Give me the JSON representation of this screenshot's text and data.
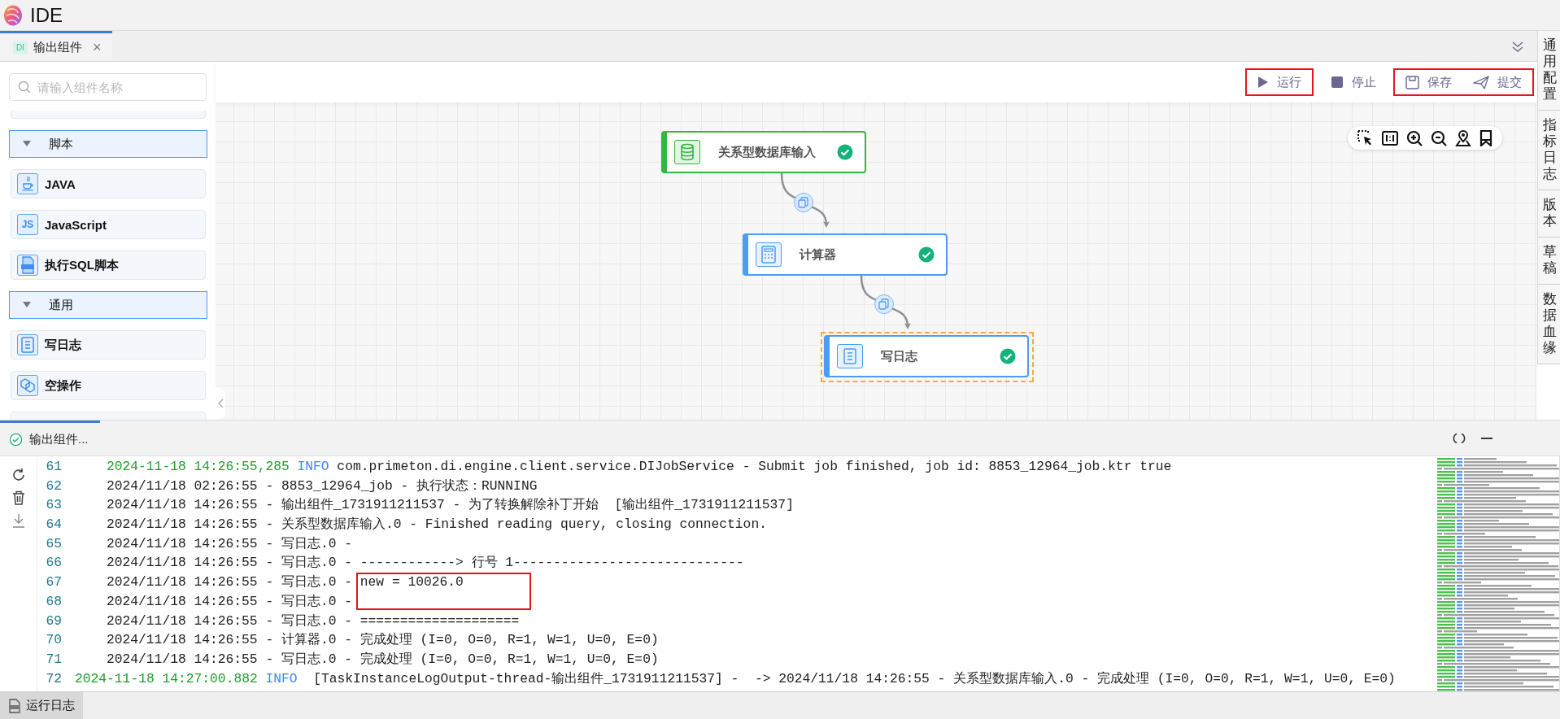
{
  "app": {
    "title": "IDE"
  },
  "tabs": [
    {
      "badge": "DI",
      "label": "输出组件",
      "close": "×",
      "selected": true
    }
  ],
  "sidebar": {
    "search": {
      "placeholder": "请输入组件名称"
    },
    "groups": [
      {
        "label": "脚本",
        "expanded": true,
        "items": [
          {
            "kind": "java",
            "label": "JAVA"
          },
          {
            "kind": "javascript",
            "badge": "JS",
            "label": "JavaScript"
          },
          {
            "kind": "sql",
            "label": "执行SQL脚本"
          }
        ]
      },
      {
        "label": "通用",
        "expanded": true,
        "items": [
          {
            "kind": "log",
            "label": "写日志"
          },
          {
            "kind": "noop",
            "label": "空操作"
          }
        ]
      }
    ]
  },
  "toolbar": {
    "groups": [
      {
        "highlighted": true,
        "buttons": [
          {
            "kind": "run",
            "label": "运行"
          }
        ]
      },
      {
        "highlighted": false,
        "buttons": [
          {
            "kind": "stop",
            "label": "停止"
          }
        ]
      },
      {
        "highlighted": true,
        "buttons": [
          {
            "kind": "save",
            "label": "保存"
          },
          {
            "kind": "submit",
            "label": "提交"
          }
        ]
      }
    ]
  },
  "canvas": {
    "tools": [
      {
        "kind": "select"
      },
      {
        "kind": "actual-size"
      },
      {
        "kind": "zoom-in"
      },
      {
        "kind": "zoom-out"
      },
      {
        "kind": "locate"
      },
      {
        "kind": "bookmark"
      }
    ],
    "nodes": [
      {
        "kind": "database",
        "label": "关系型数据库输入",
        "done": true,
        "selected": false,
        "color": "#35b544"
      },
      {
        "kind": "calculator",
        "label": "计算器",
        "done": true,
        "selected": false,
        "color": "#4a9cf7"
      },
      {
        "kind": "log",
        "label": "写日志",
        "done": true,
        "selected": true,
        "color": "#4a9cf7"
      }
    ]
  },
  "right_panel": {
    "tabs": [
      {
        "label": "通用配置"
      },
      {
        "label": "指标日志"
      },
      {
        "label": "版本"
      },
      {
        "label": "草稿"
      },
      {
        "label": "数据血缘"
      }
    ]
  },
  "run_panel": {
    "tab": {
      "label": "输出组件...",
      "done": true
    },
    "lines": [
      {
        "number": "61",
        "kind": "info",
        "indented": true,
        "time": "2024-11-18 14:26:55,285",
        "severity": "INFO",
        "message": " com.primeton.di.engine.client.service.DIJobService - Submit job finished, job id: 8853_12964_job.ktr true"
      },
      {
        "number": "62",
        "kind": "plain",
        "indented": true,
        "text": "2024/11/18 02:26:55 - 8853_12964_job - 执行状态：RUNNING"
      },
      {
        "number": "63",
        "kind": "plain",
        "indented": true,
        "text": "2024/11/18 14:26:55 - 输出组件_1731911211537 - 为了转换解除补丁开始  [输出组件_1731911211537]"
      },
      {
        "number": "64",
        "kind": "plain",
        "indented": true,
        "text": "2024/11/18 14:26:55 - 关系型数据库输入.0 - Finished reading query, closing connection."
      },
      {
        "number": "65",
        "kind": "plain",
        "indented": true,
        "text": "2024/11/18 14:26:55 - 写日志.0 -"
      },
      {
        "number": "66",
        "kind": "plain",
        "indented": true,
        "text": "2024/11/18 14:26:55 - 写日志.0 - ------------> 行号 1-----------------------------"
      },
      {
        "number": "67",
        "kind": "plain",
        "indented": true,
        "text": "2024/11/18 14:26:55 - 写日志.0 - ",
        "marked": "new = 10026.0"
      },
      {
        "number": "68",
        "kind": "plain",
        "indented": true,
        "text": "2024/11/18 14:26:55 - 写日志.0 -"
      },
      {
        "number": "69",
        "kind": "plain",
        "indented": true,
        "text": "2024/11/18 14:26:55 - 写日志.0 - ===================="
      },
      {
        "number": "70",
        "kind": "plain",
        "indented": true,
        "text": "2024/11/18 14:26:55 - 计算器.0 - 完成处理 (I=0, O=0, R=1, W=1, U=0, E=0)"
      },
      {
        "number": "71",
        "kind": "plain",
        "indented": true,
        "text": "2024/11/18 14:26:55 - 写日志.0 - 完成处理 (I=0, O=0, R=1, W=1, U=0, E=0)"
      },
      {
        "number": "72",
        "kind": "info",
        "indented": false,
        "time": "2024-11-18 14:27:00.882",
        "severity": "INFO",
        "message": "  [TaskInstanceLogOutput-thread-输出组件_1731911211537] -  -> 2024/11/18 14:26:55 - 关系型数据库输入.0 - 完成处理 (I=0, O=0, R=1, W=1, U=0, E=0)"
      }
    ]
  },
  "status_bar": {
    "tabs": [
      {
        "label": "运行日志",
        "selected": true
      }
    ]
  }
}
